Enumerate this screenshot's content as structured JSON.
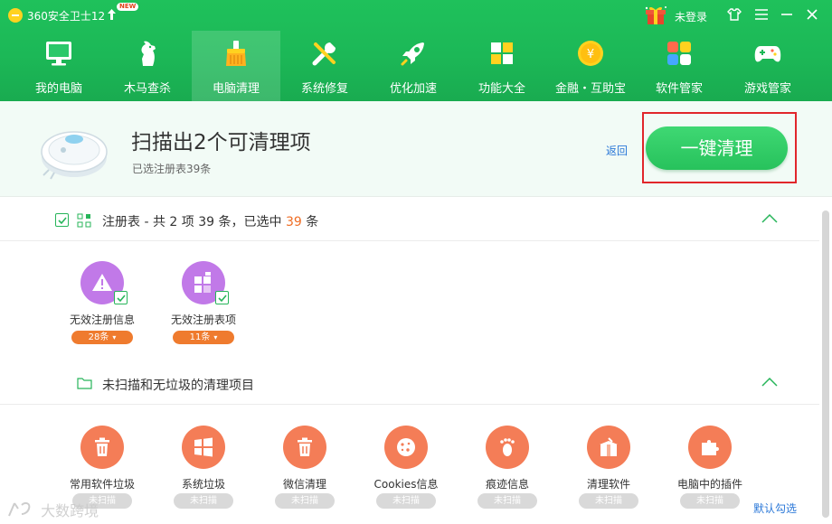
{
  "titlebar": {
    "app_title": "360安全卫士12",
    "new_badge": "NEW",
    "login_label": "未登录",
    "icons": [
      "upgrade-arrow-icon",
      "gift-icon",
      "skin-shirt-icon",
      "menu-icon",
      "minimize-icon",
      "close-icon"
    ]
  },
  "nav": {
    "tabs": [
      {
        "label": "我的电脑",
        "icon": "computer-icon"
      },
      {
        "label": "木马查杀",
        "icon": "horse-icon"
      },
      {
        "label": "电脑清理",
        "icon": "broom-icon",
        "active": true
      },
      {
        "label": "系统修复",
        "icon": "wrench-icon"
      },
      {
        "label": "优化加速",
        "icon": "rocket-icon"
      },
      {
        "label": "功能大全",
        "icon": "grid-apps-icon"
      },
      {
        "label": "金融・互助宝",
        "icon": "coin-icon"
      },
      {
        "label": "软件管家",
        "icon": "software-icon"
      },
      {
        "label": "游戏管家",
        "icon": "gamepad-icon"
      }
    ]
  },
  "result": {
    "title": "扫描出2个可清理项",
    "subtitle": "已选注册表39条",
    "back_label": "返回",
    "clean_button": "一键清理"
  },
  "registry": {
    "title_prefix": "注册表 - 共 2 项 39 条，已选中 ",
    "selected_count": "39",
    "title_suffix": " 条",
    "items": [
      {
        "label": "无效注册信息",
        "count": "28条",
        "icon": "warning-icon",
        "checked": true
      },
      {
        "label": "无效注册表项",
        "count": "11条",
        "icon": "blocks-icon",
        "checked": true
      }
    ]
  },
  "unscanned": {
    "title": "未扫描和无垃圾的清理项目",
    "items": [
      {
        "label": "常用软件垃圾",
        "status": "未扫描",
        "icon": "trash-icon"
      },
      {
        "label": "系统垃圾",
        "status": "未扫描",
        "icon": "windows-icon"
      },
      {
        "label": "微信清理",
        "status": "未扫描",
        "icon": "trash-icon"
      },
      {
        "label": "Cookies信息",
        "status": "未扫描",
        "icon": "cookie-icon"
      },
      {
        "label": "痕迹信息",
        "status": "未扫描",
        "icon": "footprint-icon"
      },
      {
        "label": "清理软件",
        "status": "未扫描",
        "icon": "box-icon"
      },
      {
        "label": "电脑中的插件",
        "status": "未扫描",
        "icon": "puzzle-icon"
      }
    ],
    "default_select_label": "默认勾选"
  },
  "watermark": {
    "text": "大数跨境"
  },
  "colors": {
    "brand_green": "#1cb857",
    "accent_orange": "#ef6d24",
    "link_blue": "#2b78d8",
    "highlight_red": "#e1262b",
    "purple": "#c179e8",
    "orange_icon": "#f47d57"
  }
}
